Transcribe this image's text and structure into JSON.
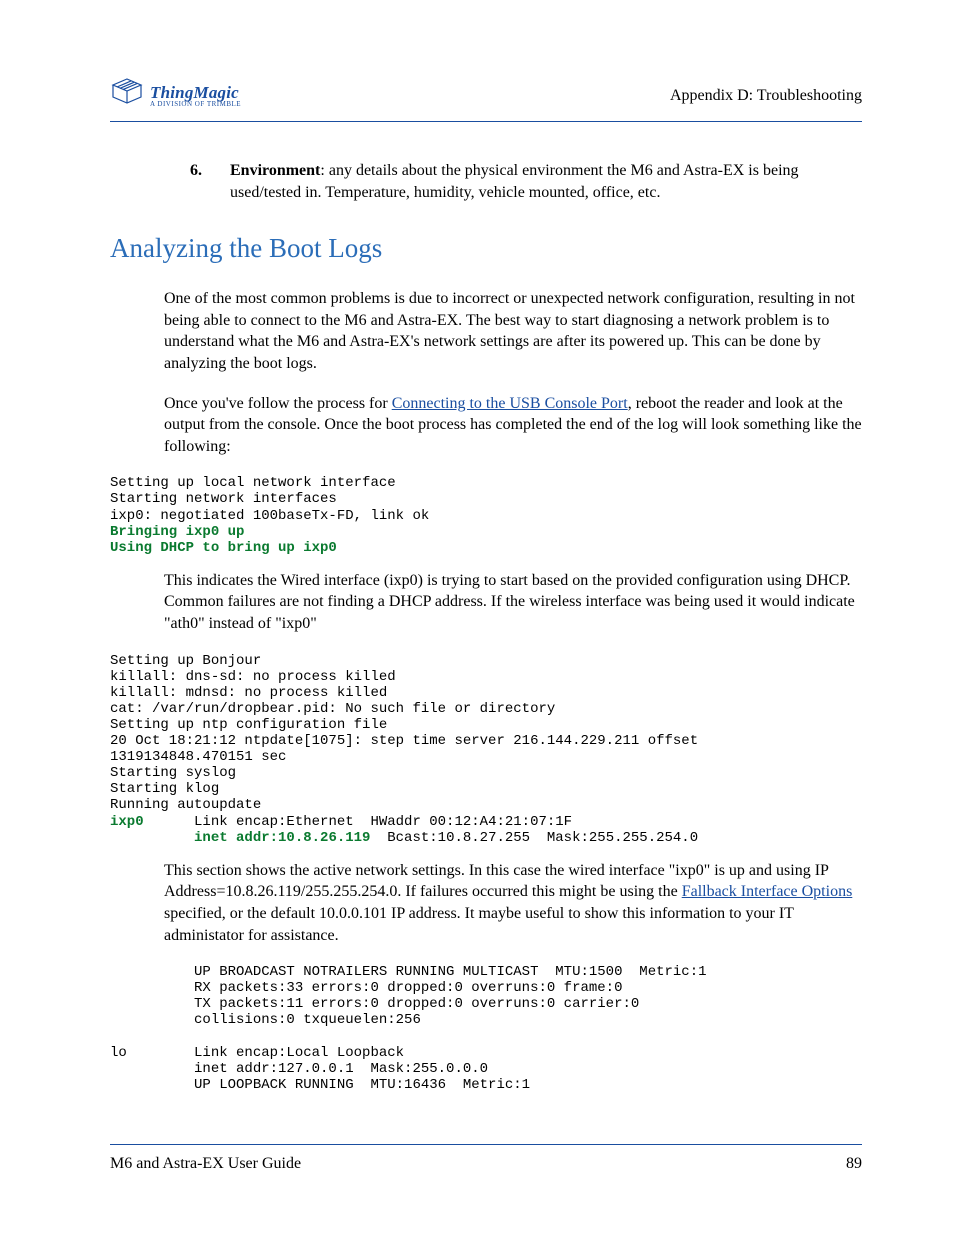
{
  "header": {
    "logo_main": "ThingMagic",
    "logo_sub": "A DIVISION OF TRIMBLE",
    "appendix": "Appendix D: Troubleshooting"
  },
  "list": {
    "num": "6.",
    "bold": "Environment",
    "text": ": any details about the physical environment the M6 and Astra-EX is being used/tested in. Temperature, humidity, vehicle mounted, office, etc."
  },
  "heading": "Analyzing the Boot Logs",
  "para1": "One of the most common problems is due to incorrect or unexpected network configuration, resulting in not being able to connect to the M6 and Astra-EX. The best way to start diagnosing a network problem is to understand what the M6 and Astra-EX's network settings are after its powered up. This can be done by analyzing the boot logs.",
  "para2a": "Once you've follow the process for ",
  "para2_link": "Connecting to the USB Console Port",
  "para2b": ", reboot the reader and look at the output from the console. Once the boot process has completed the end of the log will look something like the following:",
  "code1_plain": "Setting up local network interface\nStarting network interfaces\nixp0: negotiated 100baseTx-FD, link ok",
  "code1_green": "Bringing ixp0 up\nUsing DHCP to bring up ixp0",
  "para3": "This indicates the Wired interface (ixp0) is trying to start based on the provided configuration using DHCP. Common failures are not finding a DHCP address. If the wireless interface was being used it would indicate \"ath0\" instead of \"ixp0\"",
  "code2_plain": "Setting up Bonjour\nkillall: dns-sd: no process killed\nkillall: mdnsd: no process killed\ncat: /var/run/dropbear.pid: No such file or directory\nSetting up ntp configuration file\n20 Oct 18:21:12 ntpdate[1075]: step time server 216.144.229.211 offset\n1319134848.470151 sec\nStarting syslog\nStarting klog\nRunning autoupdate",
  "code2_iface": "ixp0",
  "code2_line_rest": "      Link encap:Ethernet  HWaddr 00:12:A4:21:07:1F",
  "code2_indent": "          ",
  "code2_inet": "inet addr:10.8.26.119",
  "code2_inet_rest": "  Bcast:10.8.27.255  Mask:255.255.254.0",
  "para4a": "This section shows the active network settings. In this case the wired interface \"ixp0\" is up and using IP Address=10.8.26.119/255.255.254.0. If failures occurred this might be using the ",
  "para4_link": "Fallback Interface Options",
  "para4b": " specified, or the default 10.0.0.101 IP address. It maybe useful to show this information to your IT administator for assistance.",
  "code3": "          UP BROADCAST NOTRAILERS RUNNING MULTICAST  MTU:1500  Metric:1\n          RX packets:33 errors:0 dropped:0 overruns:0 frame:0\n          TX packets:11 errors:0 dropped:0 overruns:0 carrier:0\n          collisions:0 txqueuelen:256\n\nlo        Link encap:Local Loopback\n          inet addr:127.0.0.1  Mask:255.0.0.0\n          UP LOOPBACK RUNNING  MTU:16436  Metric:1",
  "footer": {
    "left": "M6 and Astra-EX User Guide",
    "right": "89"
  }
}
